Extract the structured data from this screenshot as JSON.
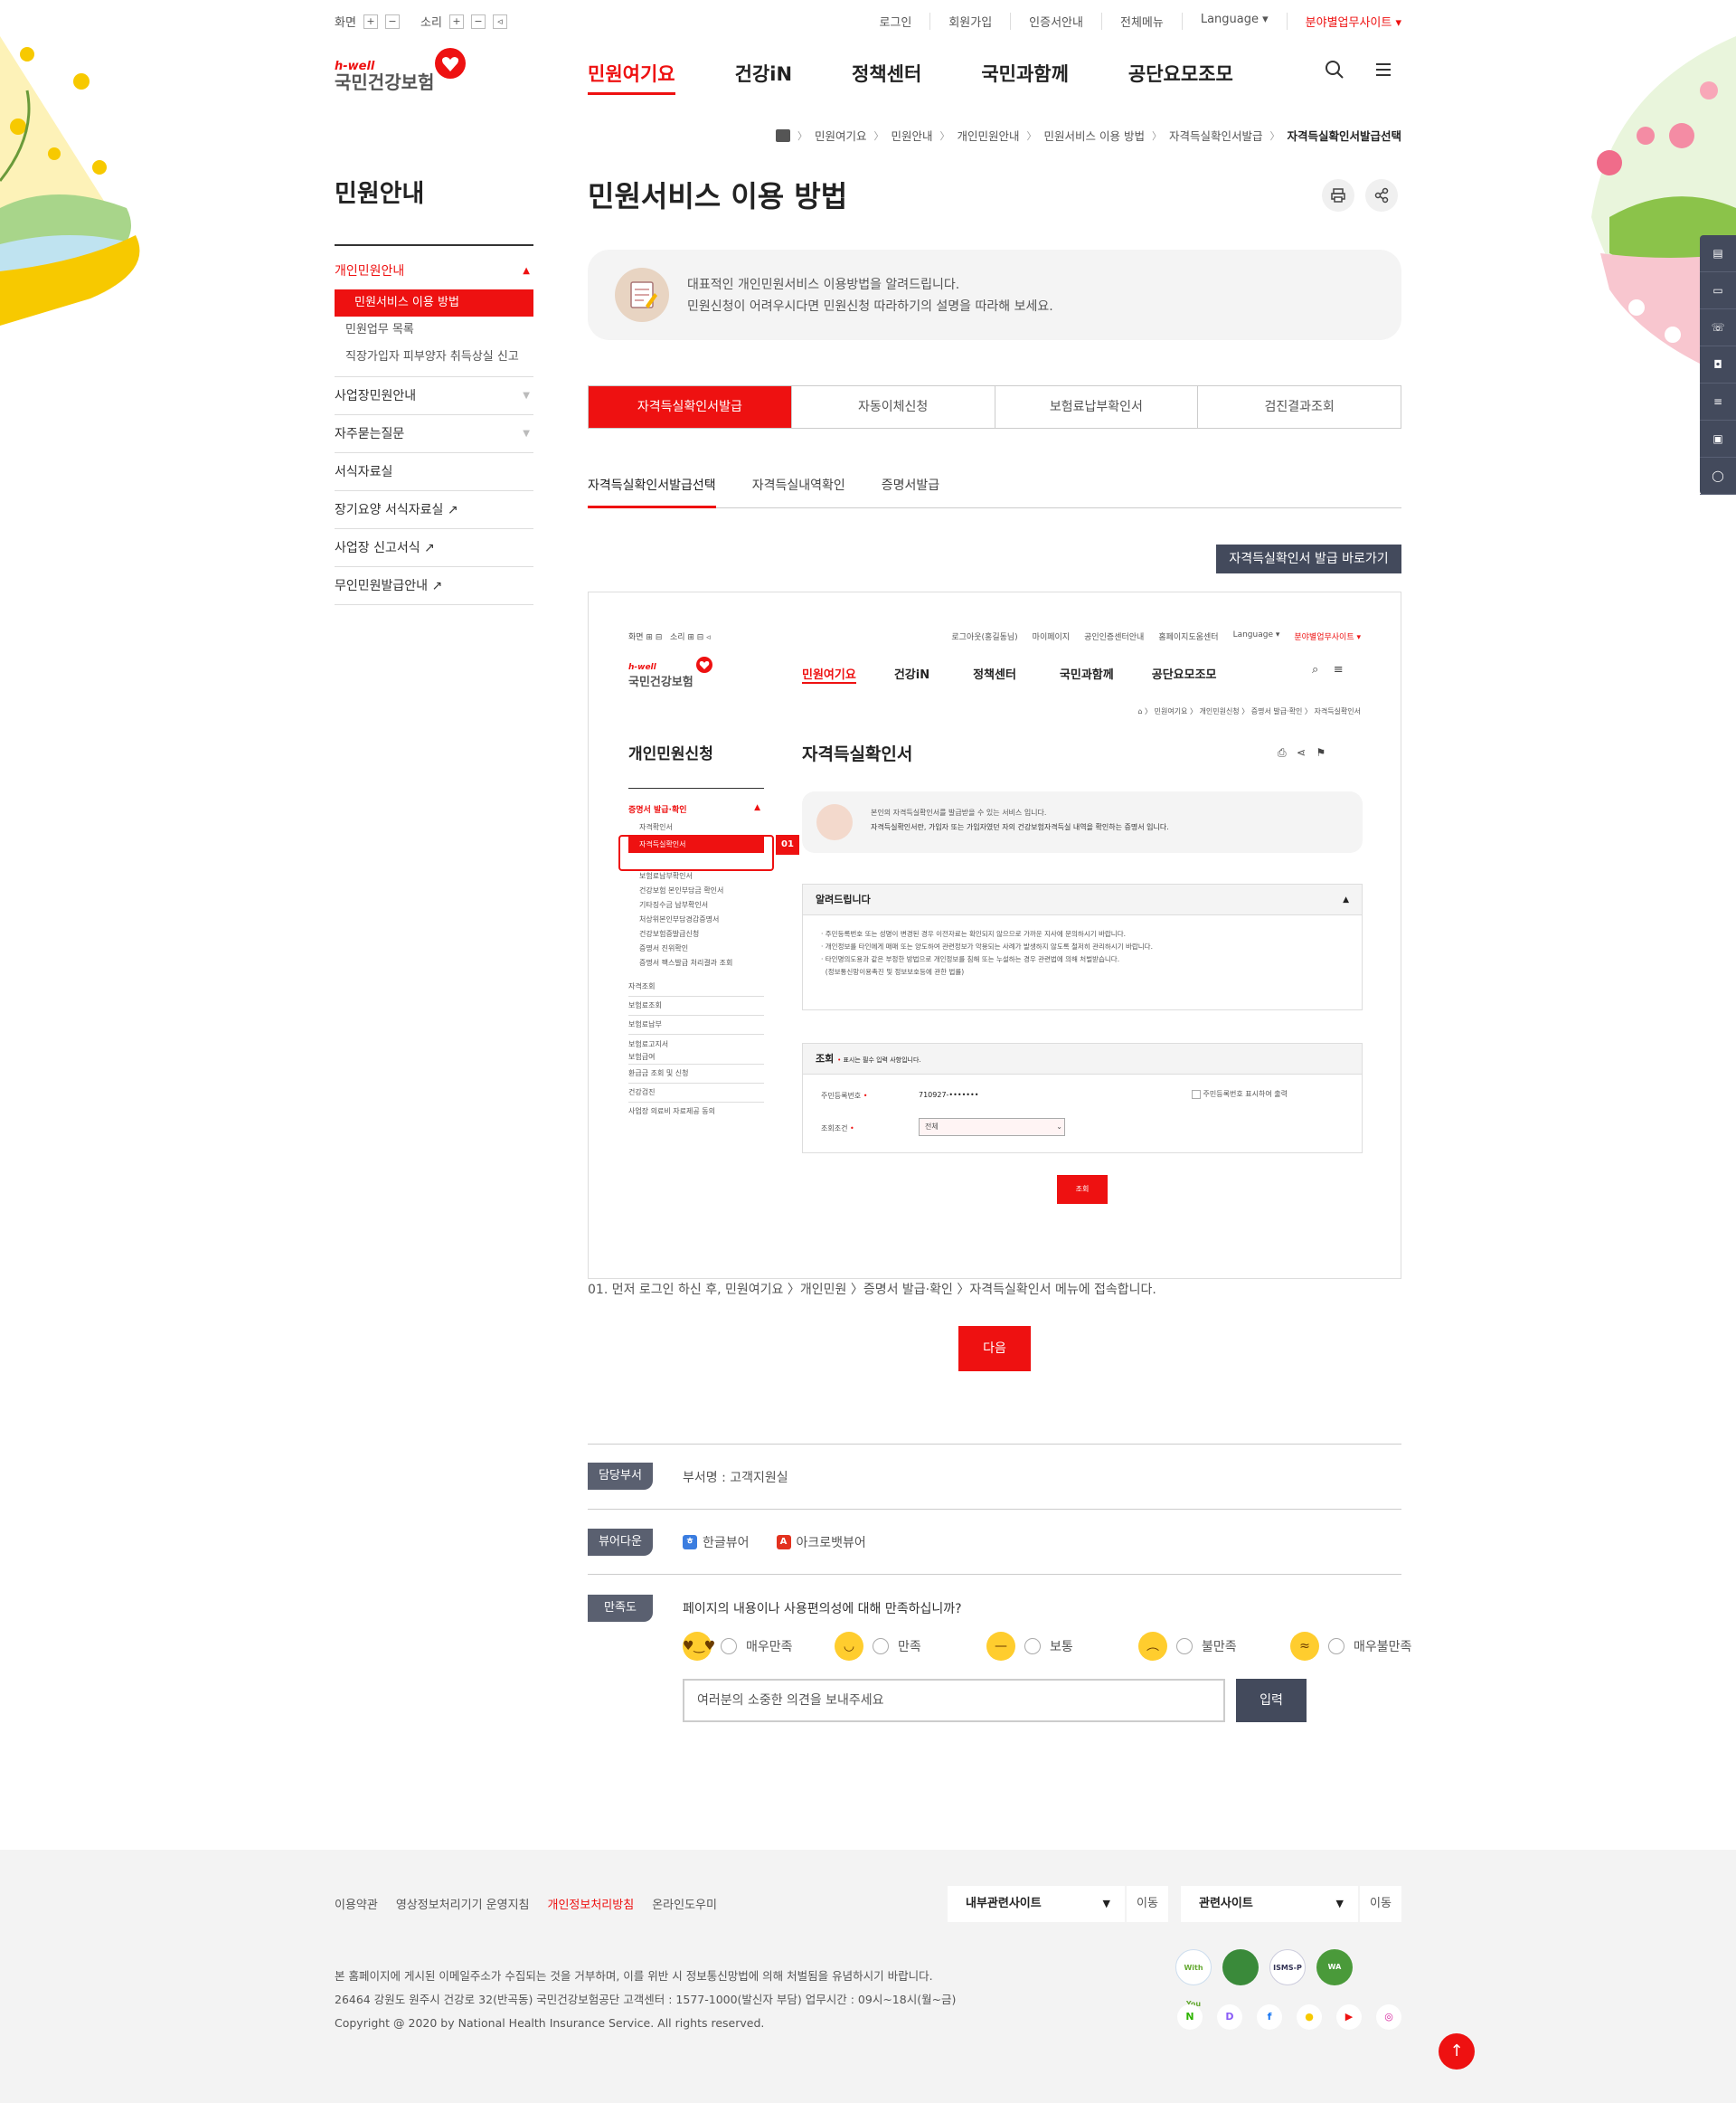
{
  "util": {
    "screen_label": "화면",
    "sound_label": "소리"
  },
  "top_links": [
    "로그인",
    "회원가입",
    "인증서안내",
    "전체메뉴",
    "Language ▾",
    "분야별업무사이트 ▾"
  ],
  "logo": {
    "small": "h-well",
    "main": "국민건강보험"
  },
  "gnb": [
    "민원여기요",
    "건강iN",
    "정책센터",
    "국민과함께",
    "공단요모조모"
  ],
  "breadcrumb": [
    "민원여기요",
    "민원안내",
    "개인민원안내",
    "민원서비스 이용 방법",
    "자격득실확인서발급",
    "자격득실확인서발급선택"
  ],
  "lnb": {
    "title": "민원안내",
    "open_item": "개인민원안내",
    "sub": [
      "민원서비스 이용 방법",
      "민원업무 목록",
      "직장가입자 피부양자 취득상실 신고"
    ],
    "items": [
      "사업장민원안내",
      "자주묻는질문",
      "서식자료실",
      "장기요양 서식자료실 ↗",
      "사업장 신고서식 ↗",
      "무인민원발급안내 ↗"
    ]
  },
  "page_title": "민원서비스 이용 방법",
  "intro": {
    "line1": "대표적인 개인민원서비스 이용방법을 알려드립니다.",
    "line2": "민원신청이 어려우시다면 민원신청 따라하기의 설명을 따라해 보세요."
  },
  "tabs": [
    "자격득실확인서발급",
    "자동이체신청",
    "보험료납부확인서",
    "검진결과조회"
  ],
  "subtabs": [
    "자격득실확인서발급선택",
    "자격득실내역확인",
    "증명서발급"
  ],
  "go_button": "자격득실확인서 발급 바로가기",
  "shot": {
    "util_screen": "화면",
    "util_sound": "소리",
    "top_links": [
      "로그아웃(홍길동님)",
      "마이페이지",
      "공인인증센터안내",
      "홈페이지도움센터",
      "Language ▾",
      "분야별업무사이트 ▾"
    ],
    "logo_small": "h-well",
    "logo_main": "국민건강보험",
    "gnb": [
      "민원여기요",
      "건강iN",
      "정책센터",
      "국민과함께",
      "공단요모조모"
    ],
    "crumb": [
      "민원여기요",
      "개인민원신청",
      "증명서 발급·확인",
      "자격득실확인서"
    ],
    "lnb_title": "개인민원신청",
    "lnb_open": "증명서 발급·확인",
    "lnb_sub": [
      "자격확인서",
      "자격득실확인서",
      "보험료납부확인서",
      "건강보험 본인부담금 확인서",
      "기타징수금 납부확인서",
      "처상위본인부담경감증명서",
      "건강보험증발급신청",
      "증명서 진위확인",
      "증명서 팩스발급 처리결과 조회"
    ],
    "lnb_items": [
      "자격조회",
      "보험료조회",
      "보험료납부",
      "보험료고지서",
      "보험급여",
      "환급금 조회 및 신청",
      "건강검진",
      "사업장 의료비 자료제공 동의"
    ],
    "marker": "01",
    "title": "자격득실확인서",
    "intro1": "본인의 자격득실확인서를 발급받을 수 있는 서비스 입니다.",
    "intro2": "자격득실확인서란, 가입자 또는 가입자였던 자의 건강보험자격득실 내역을 확인하는 증명서 입니다.",
    "notice_title": "알려드립니다",
    "notices": [
      "주민등록번호 또는 성명이 변경된 경우 이전자료는 확인되지 않으므로 가까운 지사에 문의하시기 바랍니다.",
      "개인정보를 타인에게 매매 또는 양도하여 관련정보가 악용되는 사례가 발생하지 않도록 철저히 관리하시기 바랍니다.",
      "타인명의도용과 같은 부정한 방법으로 개인정보를 침해 또는 누설하는 경우 관련법에 의해 처벌받습니다.",
      "(정보통신망이용촉진 및 정보보호등에 관한 법률)"
    ],
    "query_title": "조회",
    "query_note": "표시는 필수 입력 사항입니다.",
    "rrn_label": "주민등록번호",
    "rrn_value": "710927-•••••••",
    "rrn_check": "주민등록번호 표시하여 출력",
    "cond_label": "조회조건",
    "cond_value": "전체",
    "query_button": "조회"
  },
  "caption": "01. 먼저 로그인 하신 후, 민원여기요 〉개인민원 〉증명서 발급·확인 〉자격득실확인서 메뉴에 접속합니다.",
  "next_button": "다음",
  "dept": {
    "label": "담당부서",
    "text": "부서명 : 고객지원실"
  },
  "viewer": {
    "label": "뷰어다운",
    "items": [
      "한글뷰어",
      "아크로뱃뷰어"
    ]
  },
  "satisfaction": {
    "label": "만족도",
    "question": "페이지의 내용이나 사용편의성에 대해 만족하십니까?",
    "options": [
      "매우만족",
      "만족",
      "보통",
      "불만족",
      "매우불만족"
    ],
    "placeholder": "여러분의 소중한 의견을 보내주세요",
    "submit": "입력"
  },
  "footer": {
    "links": [
      "이용약관",
      "영상정보처리기기 운영지침",
      "개인정보처리방침",
      "온라인도우미"
    ],
    "select1": "내부관련사이트",
    "select2": "관련사이트",
    "go": "이동",
    "info1": "본 홈페이지에 게시된 이메일주소가 수집되는 것을 거부하며, 이를 위반 시 정보통신망법에 의해 처벌됨을 유념하시기 바랍니다.",
    "info2": "26464 강원도 원주시 건강로 32(반곡동) 국민건강보험공단 고객센터 : 1577-1000(발신자 부담) 업무시간 : 09시~18시(월~금)",
    "copyright": "Copyright @ 2020 by National Health Insurance Service. All rights reserved.",
    "certs": [
      "With You",
      "",
      "ISMS-P",
      "WA"
    ]
  },
  "colors": {
    "brand": "#e11",
    "dark": "#434a5c"
  }
}
